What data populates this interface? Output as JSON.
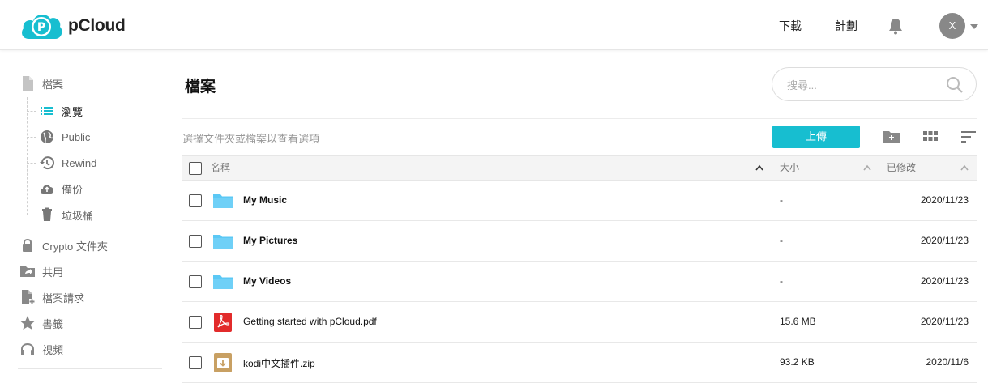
{
  "header": {
    "brand": "pCloud",
    "nav_download": "下載",
    "nav_plans": "計劃",
    "avatar_initial": "X"
  },
  "sidebar": {
    "items": [
      {
        "label": "檔案",
        "icon": "file-icon"
      },
      {
        "label": "瀏覽",
        "icon": "list-icon"
      },
      {
        "label": "Public",
        "icon": "globe-icon"
      },
      {
        "label": "Rewind",
        "icon": "history-icon"
      },
      {
        "label": "備份",
        "icon": "cloud-upload-icon"
      },
      {
        "label": "垃圾桶",
        "icon": "trash-icon"
      },
      {
        "label": "Crypto 文件夾",
        "icon": "lock-icon"
      },
      {
        "label": "共用",
        "icon": "shared-folder-icon"
      },
      {
        "label": "檔案請求",
        "icon": "file-request-icon"
      },
      {
        "label": "書籤",
        "icon": "star-icon"
      },
      {
        "label": "視頻",
        "icon": "headphones-icon"
      }
    ]
  },
  "main": {
    "title": "檔案",
    "search_placeholder": "搜尋...",
    "hint": "選擇文件夾或檔案以查看選項",
    "upload_label": "上傳",
    "columns": {
      "name": "名稱",
      "size": "大小",
      "modified": "已修改"
    },
    "rows": [
      {
        "name": "My Music",
        "type": "folder",
        "size": "-",
        "modified": "2020/11/23"
      },
      {
        "name": "My Pictures",
        "type": "folder",
        "size": "-",
        "modified": "2020/11/23"
      },
      {
        "name": "My Videos",
        "type": "folder",
        "size": "-",
        "modified": "2020/11/23"
      },
      {
        "name": "Getting started with pCloud.pdf",
        "type": "pdf",
        "size": "15.6 MB",
        "modified": "2020/11/23"
      },
      {
        "name": "kodi中文插件.zip",
        "type": "zip",
        "size": "93.2 KB",
        "modified": "2020/11/6"
      }
    ]
  },
  "colors": {
    "accent": "#17bed0",
    "folder": "#5bc8f5",
    "pdf": "#e22b2b",
    "zip": "#c8a063"
  }
}
